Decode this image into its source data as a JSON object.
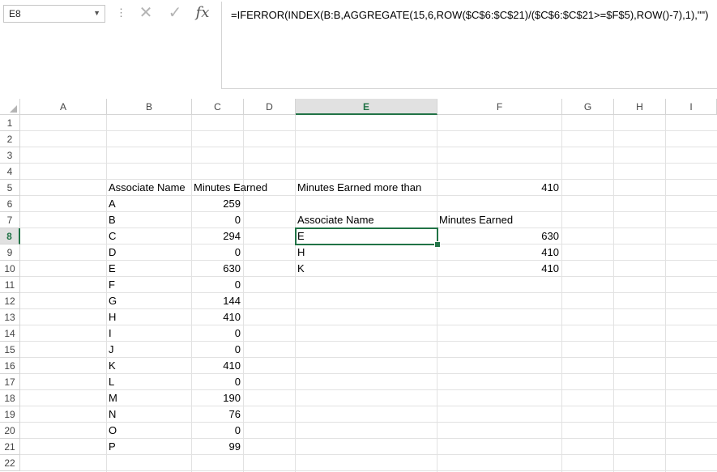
{
  "name_box": {
    "value": "E8"
  },
  "formula_bar": {
    "formula": "=IFERROR(INDEX(B:B,AGGREGATE(15,6,ROW($C$6:$C$21)/($C$6:$C$21>=$F$5),ROW()-7),1),\"\")",
    "cancel_icon": "close-icon",
    "enter_icon": "check-icon",
    "function_icon": "fx-icon"
  },
  "active_cell": {
    "column": "E",
    "row": 8
  },
  "columns": [
    "A",
    "B",
    "C",
    "D",
    "E",
    "F",
    "G",
    "H",
    "I"
  ],
  "rows": [
    1,
    2,
    3,
    4,
    5,
    6,
    7,
    8,
    9,
    10,
    11,
    12,
    13,
    14,
    15,
    16,
    17,
    18,
    19,
    20,
    21,
    22
  ],
  "cells": {
    "b5": "Associate Name",
    "c5": "Minutes Earned",
    "e5": "Minutes Earned more than",
    "f5": "410",
    "e7": "Associate Name",
    "f7": "Minutes Earned",
    "e8": "E",
    "f8": "630",
    "e9": "H",
    "f9": "410",
    "e10": "K",
    "f10": "410"
  },
  "associates": [
    {
      "name": "A",
      "minutes": "259"
    },
    {
      "name": "B",
      "minutes": "0"
    },
    {
      "name": "C",
      "minutes": "294"
    },
    {
      "name": "D",
      "minutes": "0"
    },
    {
      "name": "E",
      "minutes": "630"
    },
    {
      "name": "F",
      "minutes": "0"
    },
    {
      "name": "G",
      "minutes": "144"
    },
    {
      "name": "H",
      "minutes": "410"
    },
    {
      "name": "I",
      "minutes": "0"
    },
    {
      "name": "J",
      "minutes": "0"
    },
    {
      "name": "K",
      "minutes": "410"
    },
    {
      "name": "L",
      "minutes": "0"
    },
    {
      "name": "M",
      "minutes": "190"
    },
    {
      "name": "N",
      "minutes": "76"
    },
    {
      "name": "O",
      "minutes": "0"
    },
    {
      "name": "P",
      "minutes": "99"
    }
  ],
  "colors": {
    "accent": "#217346",
    "gridline": "#e2e2e2",
    "header_border": "#d4d4d4"
  }
}
